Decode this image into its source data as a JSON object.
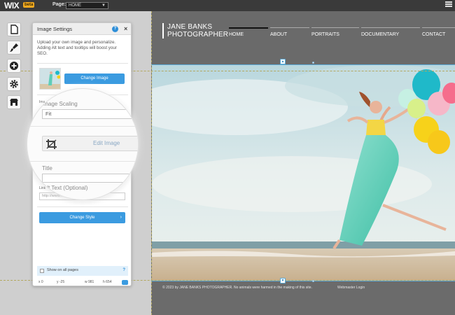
{
  "editor": {
    "logo": "WIX",
    "logo_badge": "beta",
    "page_label": "Page:",
    "page_select_value": "HOME"
  },
  "toolbar": {
    "items": [
      {
        "name": "pages",
        "icon": "page-icon"
      },
      {
        "name": "design",
        "icon": "brush-icon"
      },
      {
        "name": "add",
        "icon": "plus-icon"
      },
      {
        "name": "settings",
        "icon": "gear-icon"
      },
      {
        "name": "market",
        "icon": "store-icon"
      }
    ]
  },
  "panel": {
    "title": "Image Settings",
    "help": "?",
    "close": "×",
    "description": "Upload your own image and personalize. Adding Alt text and tooltips will boost your SEO.",
    "change_image_label": "Change Image",
    "image_scaling_label": "Image Scaling",
    "image_scaling_short_label": "Ima",
    "image_scaling_value": "Fit",
    "edit_image_label": "Edit Image",
    "title_label": "Title",
    "alt_text_label": "Alt Text (Optional)",
    "link_label": "Link",
    "link_placeholder": "http://www...",
    "change_style_label": "Change Style",
    "show_on_all_pages_label": "Show on all pages",
    "coords": {
      "x": "x 0",
      "y": "y -25",
      "w": "w 981",
      "h": "h 654"
    }
  },
  "site": {
    "brand_line1": "JANE BANKS",
    "brand_line2": "PHOTOGRAPHER",
    "nav": [
      "HOME",
      "ABOUT",
      "PORTRAITS",
      "DOCUMENTARY",
      "CONTACT"
    ],
    "active_nav": "HOME",
    "footer_text": "© 2023 by JANE BANKS PHOTOGRAPHER. No animals were harmed in the making of this site.",
    "footer_link": "Webmaster Login"
  },
  "colors": {
    "accent": "#3b9be0",
    "topbar": "#3a3a3a",
    "site_bg": "#6b6b6b",
    "guide": "#b3a860"
  }
}
